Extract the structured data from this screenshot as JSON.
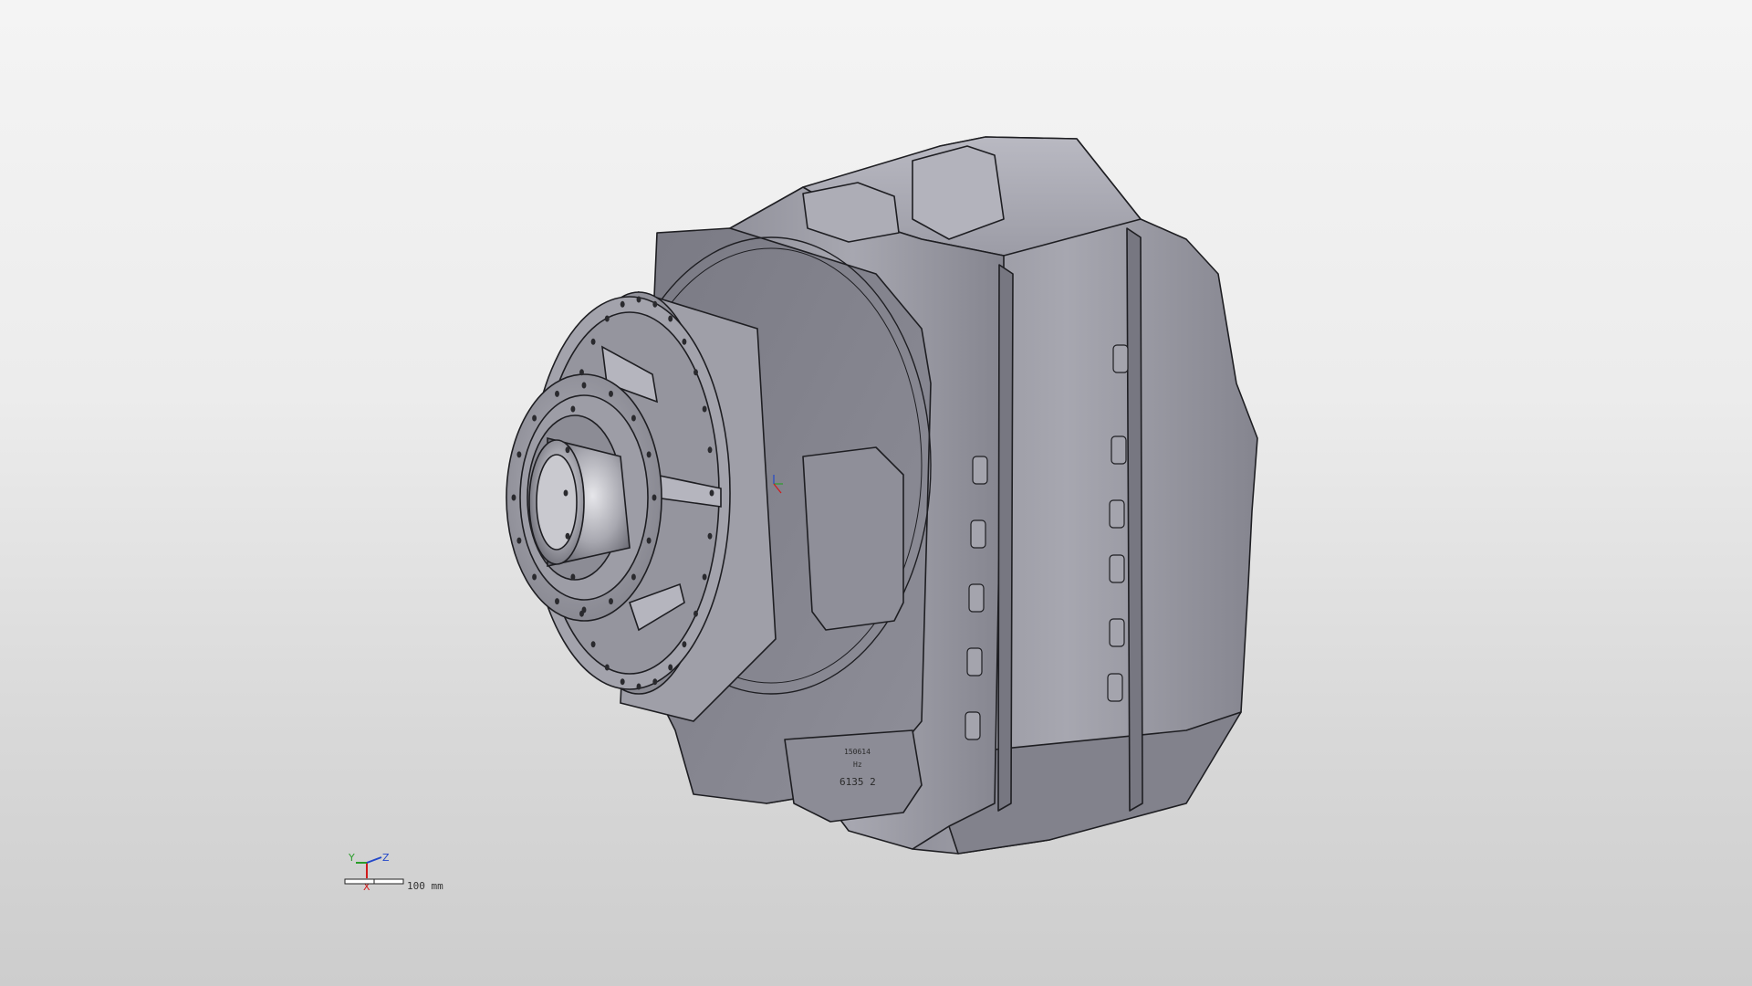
{
  "viewport": {
    "background_top": "#f4f4f4",
    "background_bottom": "#cdcdcd",
    "model": {
      "part_color": "#9a9aa3",
      "edge_color": "#1e1e22",
      "casting_marks": [
        "150614",
        "Hz",
        "6135 2"
      ]
    },
    "triad": {
      "x_label": "X",
      "y_label": "Y",
      "z_label": "Z",
      "x_color": "#d11a1a",
      "y_color": "#2a9d2a",
      "z_color": "#2348c9"
    },
    "scale_bar": {
      "label": "100 mm"
    }
  }
}
